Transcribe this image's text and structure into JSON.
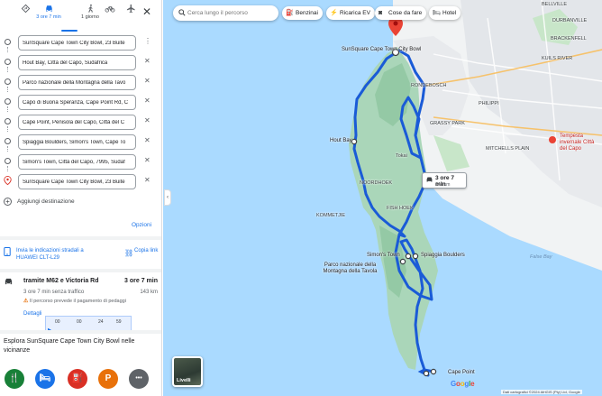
{
  "colors": {
    "accent": "#1a73e8",
    "route": "#1a5bd7",
    "warning": "#e8710a",
    "land": "#aad6b9",
    "sea": "#aadaff"
  },
  "modes": [
    {
      "name": "best-route",
      "icon": "route-icon",
      "label": ""
    },
    {
      "name": "drive",
      "icon": "car-icon",
      "label": "3 ore 7 min",
      "active": true
    },
    {
      "name": "walk",
      "icon": "walking-icon",
      "label": "1 giorno"
    },
    {
      "name": "bike",
      "icon": "bicycle-icon",
      "label": ""
    },
    {
      "name": "flight",
      "icon": "plane-icon",
      "label": ""
    }
  ],
  "stops": [
    "SunSquare Cape Town City Bowl, 23 Buite",
    "Hout Bay, Città del Capo, Sudafrica",
    "Parco nazionale della Montagna della Tavo",
    "Capo di Buona Speranza, Cape Point Rd, C",
    "Cape Point, Penisola del Capo, Città del C",
    "Spiaggia Boulders, Simon's Town, Cape To",
    "Simon's Town, Città del Capo, 7995, Sudaf",
    "SunSquare Cape Town City Bowl, 23 Buite"
  ],
  "add_destination": "Aggiungi destinazione",
  "options": "Opzioni",
  "send": {
    "text": "Invia le indicazioni stradali a HUAWEI CLT-L29",
    "copy_link": "Copia link"
  },
  "route": {
    "via": "tramite M62 e Victoria Rd",
    "duration": "3 ore 7 min",
    "traffic": "3 ore 7 min senza traffico",
    "distance": "143 km",
    "warning": "Il percorso prevede il pagamento di pedaggi",
    "details": "Dettagli"
  },
  "video_overlay": [
    "00",
    "00",
    "24",
    "59"
  ],
  "explore": "Esplora SunSquare Cape Town City Bowl nelle vicinanze",
  "categories": [
    {
      "name": "restaurants",
      "icon": "fork-knife-icon",
      "glyph": "🍴",
      "color": "#188038"
    },
    {
      "name": "hotels",
      "icon": "bed-icon",
      "glyph": "🛏",
      "color": "#1a73e8"
    },
    {
      "name": "fuel",
      "icon": "fuel-icon",
      "glyph": "⛽",
      "color": "#d93025"
    },
    {
      "name": "parking",
      "icon": "parking-icon",
      "glyph": "P",
      "color": "#e8710a"
    },
    {
      "name": "more",
      "icon": "more-icon",
      "glyph": "•••",
      "color": "#5f6368"
    }
  ],
  "map": {
    "search_placeholder": "Cerca lungo il percorso",
    "chips": [
      {
        "icon": "fuel-icon",
        "glyph": "⛽",
        "label": "Benzinai"
      },
      {
        "icon": "ev-charger-icon",
        "glyph": "⚡",
        "label": "Ricarica EV"
      },
      {
        "icon": "camera-icon",
        "glyph": "◙",
        "label": "Cose da fare"
      },
      {
        "icon": "bed-icon",
        "glyph": "🛏",
        "label": "Hotel"
      }
    ],
    "time_box": {
      "time": "3 ore 7 min",
      "distance": "143 km"
    },
    "labels": {
      "origin": "SunSquare Cape Town City Bowl",
      "hout_bay": "Hout Bay",
      "simons_town": "Simon's Town",
      "boulders": "Spiaggia Boulders",
      "park": "Parco nazionale della Montagna della Tavola",
      "cape_point": "Cape Point",
      "rondebosch": "RONDEBOSCH",
      "grassy_park": "GRASSY PARK",
      "mitchells_plain": "MITCHELLS PLAIN",
      "kuils_river": "KUILS RIVER",
      "bellville": "BELLVILLE",
      "durbanville": "DURBANVILLE",
      "brackenfell": "BRACKENFELL",
      "kommetjie": "KOMMETJIE",
      "noordhoek": "NOORDHOEK",
      "fish_hoek": "FISH HOEK",
      "tokai": "Tokai",
      "philippi": "PHILIPPI",
      "false_bay": "False Bay",
      "tempesta": "Tempesta invernale Città del Capo",
      "livelli": "Livelli",
      "google": "Google",
      "attribution": "Dati cartografici ©2024 AfriGIS (Pty) Ltd, Google"
    }
  }
}
